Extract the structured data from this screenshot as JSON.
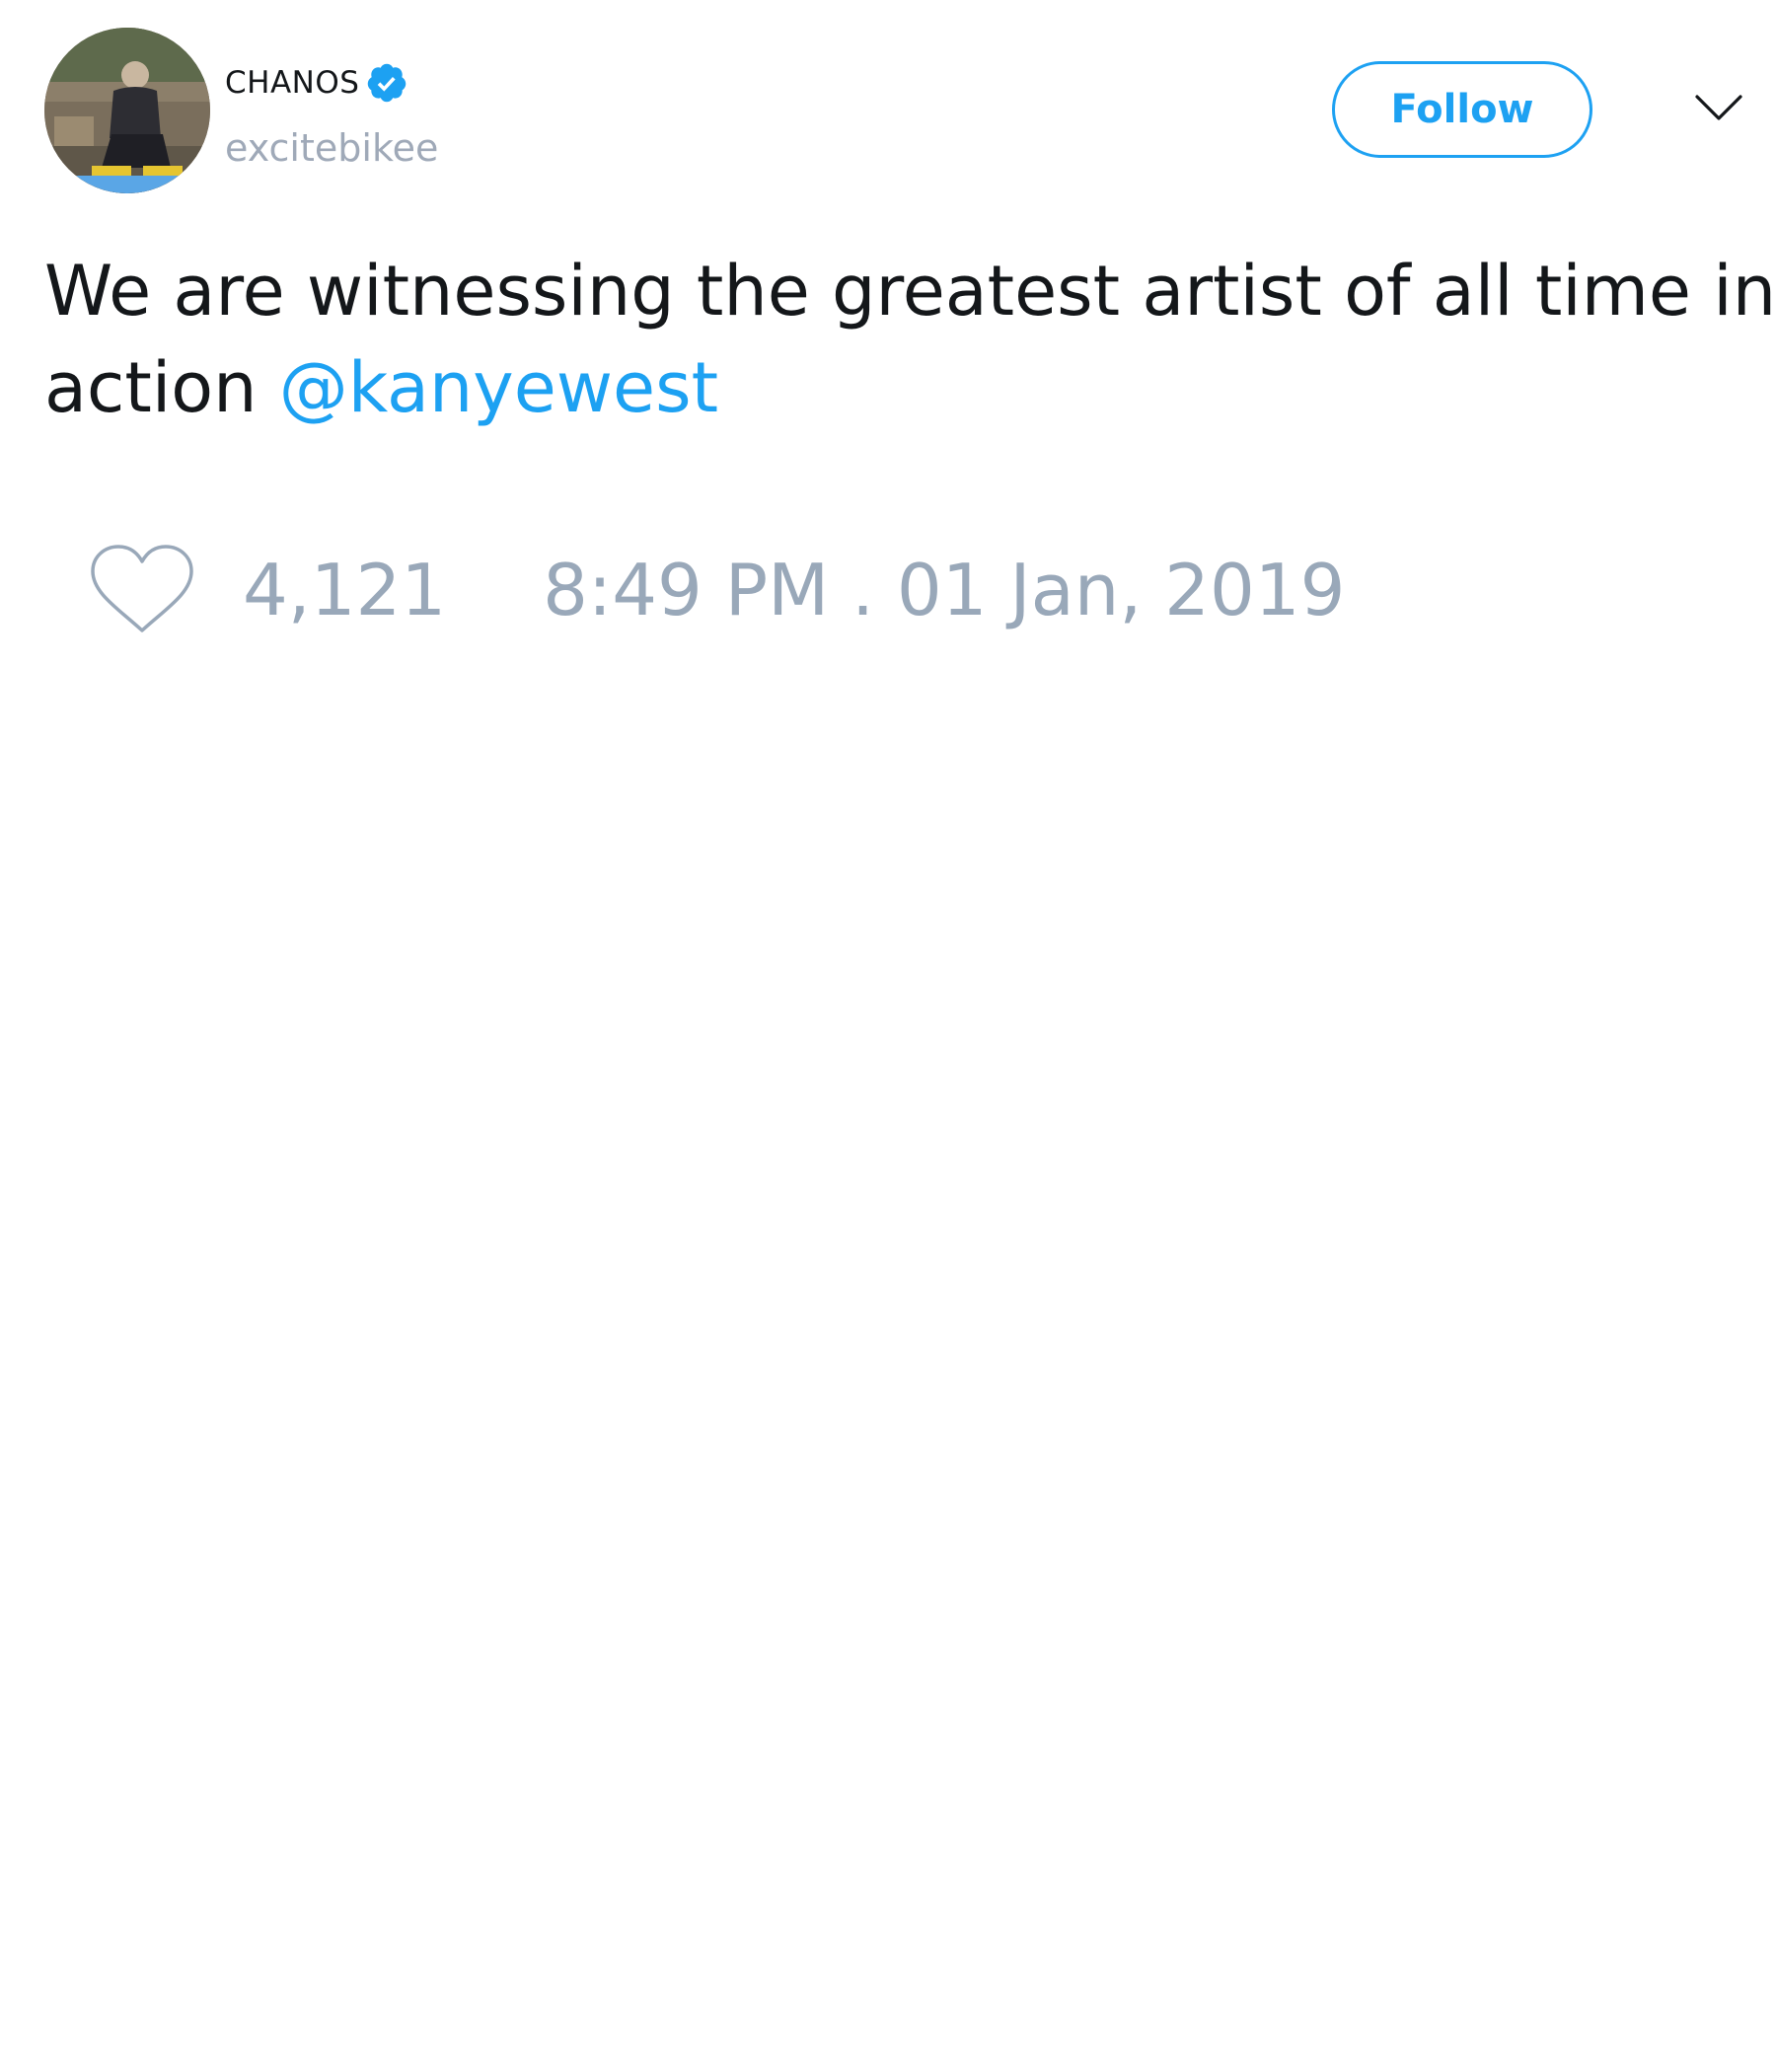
{
  "tweet": {
    "author": {
      "display_name": "CHANOS",
      "handle": "excitebikee",
      "verified": true,
      "avatar_icon": "user-photo-avatar"
    },
    "follow_label": "Follow",
    "menu_icon": "chevron-down-icon",
    "text_line1": "We are witnessing the greatest artist of all time in",
    "text_line2_prefix": "action ",
    "mention": "@kanyewest",
    "likes": "4,121",
    "like_icon": "heart-outline-icon",
    "timestamp": "8:49 PM . 01 Jan, 2019"
  },
  "colors": {
    "accent": "#1da1f2",
    "text_primary": "#14171a",
    "text_secondary": "#99a8b9",
    "background": "#ffffff"
  }
}
